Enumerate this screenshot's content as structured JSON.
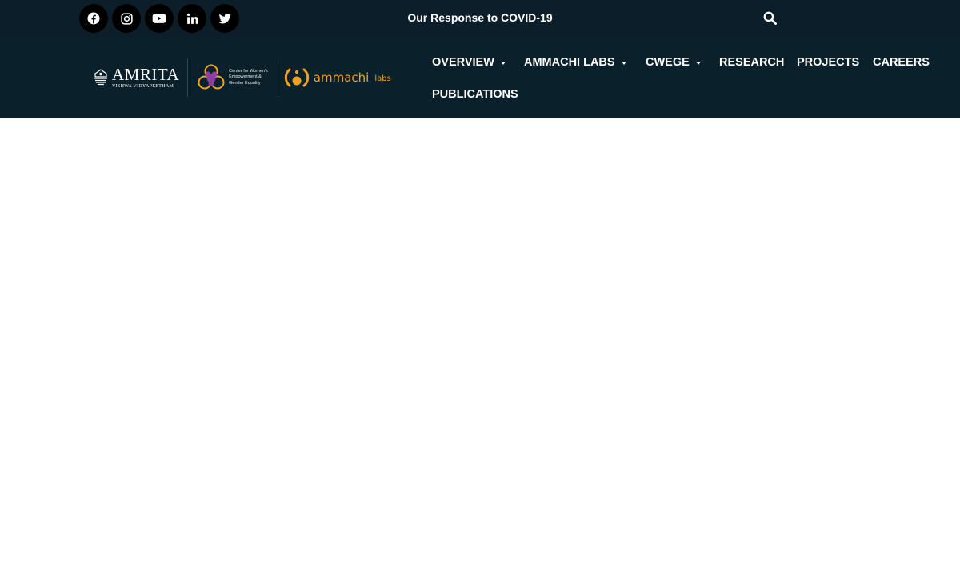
{
  "topbar": {
    "social": [
      {
        "name": "facebook-icon"
      },
      {
        "name": "instagram-icon"
      },
      {
        "name": "youtube-icon"
      },
      {
        "name": "linkedin-icon"
      },
      {
        "name": "twitter-icon"
      }
    ],
    "covid_link": "Our Response to COVID-19",
    "search_icon": "search-icon"
  },
  "logos": {
    "amrita_title": "AMRITA",
    "amrita_sub": "VISHWA VIDYAPEETHAM",
    "cwege_line1": "Center for Women's",
    "cwege_line2": "Empowerment &",
    "cwege_line3": "Gender Equality",
    "ammachi": "ammachi",
    "ammachi_labs": "labs"
  },
  "nav": {
    "overview": "OVERVIEW",
    "ammachi_labs": "AMMACHI LABS",
    "cwege": "CWEGE",
    "research": "RESEARCH",
    "projects": "PROJECTS",
    "careers": "CAREERS",
    "publications": "PUBLICATIONS"
  },
  "colors": {
    "topbar_bg": "#0c1e2a",
    "navbar_bg": "#0a212b",
    "accent_orange": "#f0a21e",
    "cwege_purple": "#8e3fa0"
  }
}
